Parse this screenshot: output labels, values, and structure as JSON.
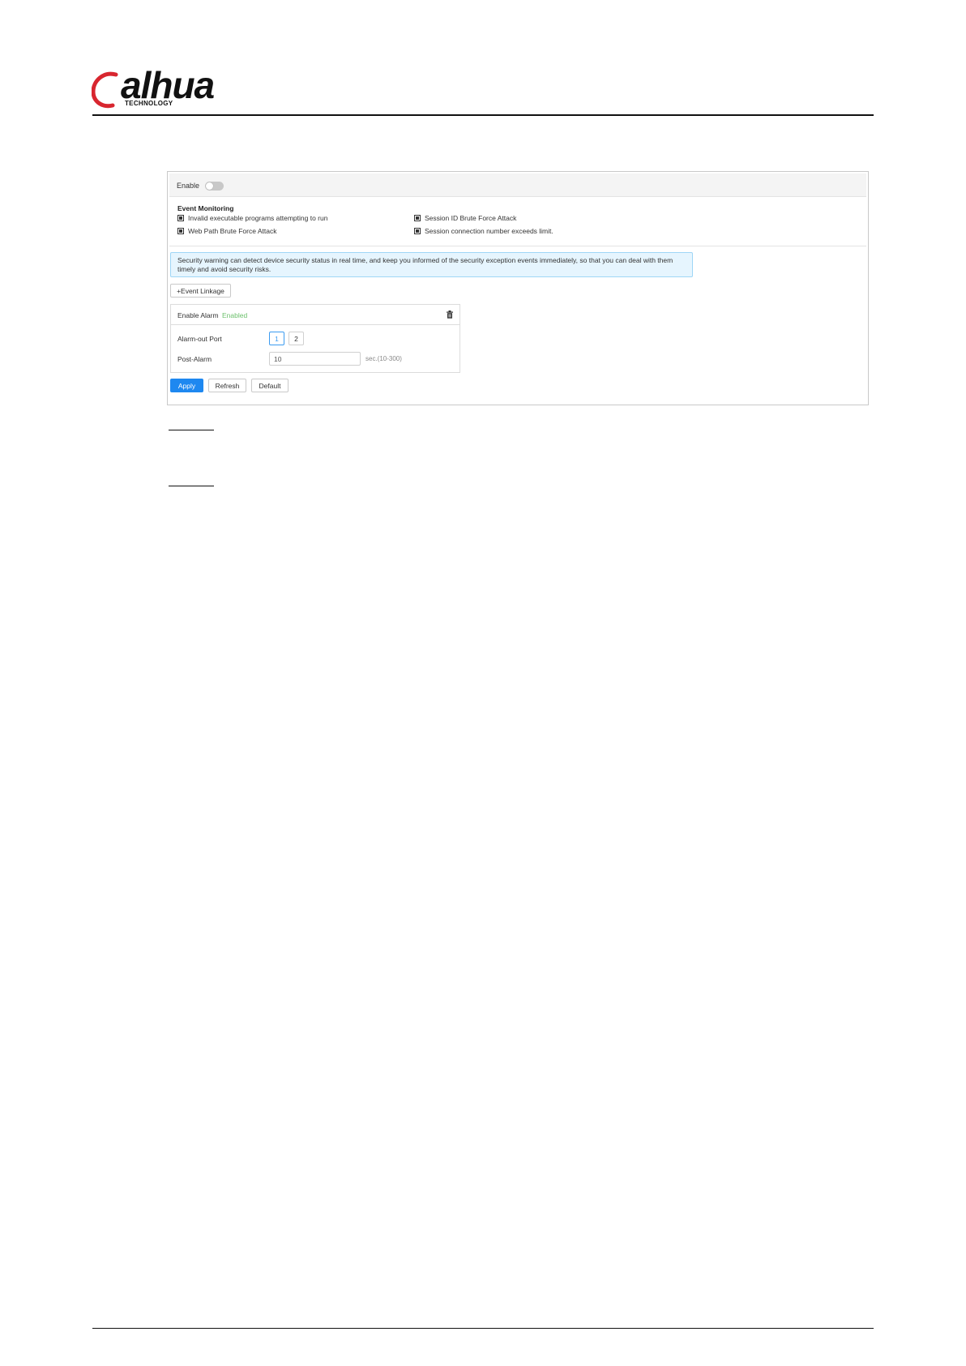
{
  "brand": {
    "logo_text": "alhua",
    "logo_subtext": "TECHNOLOGY",
    "logo_colors": {
      "ring": "#d8262f",
      "text": "#111111"
    }
  },
  "screenshot": {
    "enable_label": "Enable",
    "enable_on": false,
    "event_monitoring": {
      "title": "Event Monitoring",
      "items": [
        {
          "label": "Invalid executable programs attempting to run",
          "checked": true
        },
        {
          "label": "Session ID Brute Force Attack",
          "checked": true
        },
        {
          "label": "Web Path Brute Force Attack",
          "checked": true
        },
        {
          "label": "Session connection number exceeds limit.",
          "checked": true
        }
      ]
    },
    "tip": "Security warning can detect device security status in real time, and keep you informed of the security exception events immediately, so that you can deal with them timely and avoid security risks.",
    "event_linkage_button": "+Event Linkage",
    "alarm": {
      "title": "Enable Alarm",
      "status": "Enabled",
      "port_label": "Alarm-out Port",
      "ports": [
        "1",
        "2"
      ],
      "selected_port": "1",
      "post_alarm_label": "Post-Alarm",
      "post_alarm_value": "10",
      "post_alarm_unit": "sec.(10-300)"
    },
    "buttons": {
      "apply": "Apply",
      "refresh": "Refresh",
      "default": "Default"
    }
  },
  "accent_color": "#1e88f0"
}
